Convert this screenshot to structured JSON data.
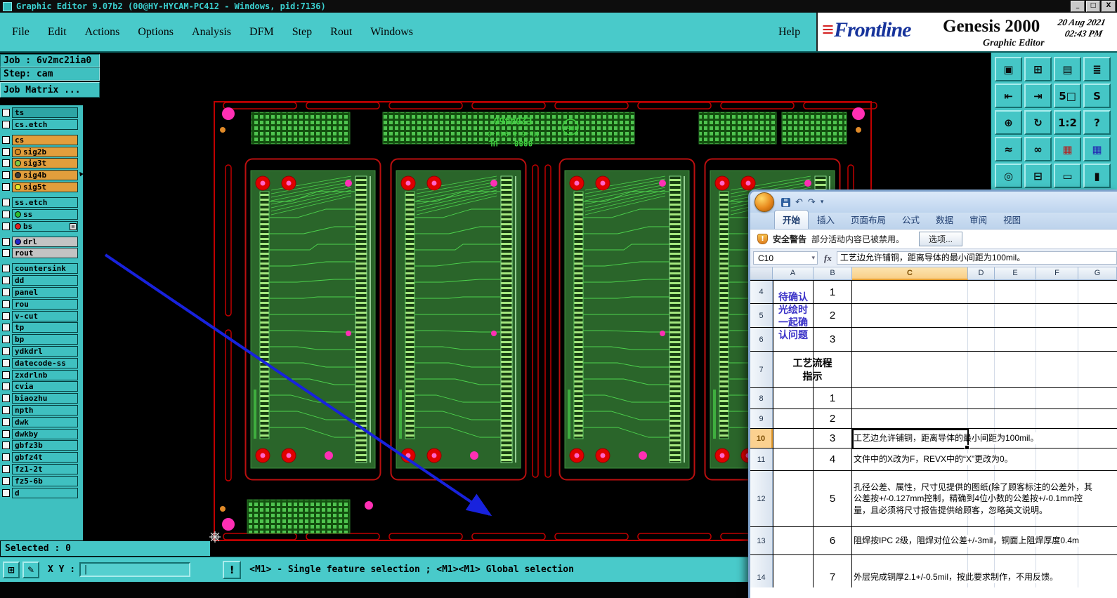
{
  "window": {
    "title": "Graphic Editor 9.07b2 (00@HY-HYCAM-PC412 - Windows, pid:7136)",
    "minimize": "_",
    "maximize": "□",
    "close": "X"
  },
  "menu": {
    "items": [
      "File",
      "Edit",
      "Actions",
      "Options",
      "Analysis",
      "DFM",
      "Step",
      "Rout",
      "Windows"
    ],
    "help": "Help"
  },
  "brand": {
    "logo_glyph": "≡",
    "name": "Frontline",
    "product": "Genesis 2000",
    "date": "20 Aug 2021",
    "time": "02:43 PM",
    "subtitle": "Graphic Editor"
  },
  "job_panel": {
    "job": "Job : 6v2mc21ia0",
    "step": "Step: cam",
    "matrix": "Job Matrix ..."
  },
  "layers": [
    {
      "name": "ts",
      "type": "teal",
      "active": true
    },
    {
      "name": "cs.etch",
      "type": "teal"
    },
    {
      "name": "cs",
      "type": "orange",
      "gap": true
    },
    {
      "name": "sig2b",
      "type": "orange",
      "dot": "#d98c1f"
    },
    {
      "name": "sig3t",
      "type": "orange",
      "dot": "#7fc843"
    },
    {
      "name": "sig4b",
      "type": "orange",
      "dot": "#3c3c3c",
      "cursor": true
    },
    {
      "name": "sig5t",
      "type": "orange",
      "dot": "#e8e82a"
    },
    {
      "name": "ss.etch",
      "type": "teal",
      "gap": true
    },
    {
      "name": "ss",
      "type": "teal",
      "dot": "#2fbf2f"
    },
    {
      "name": "bs",
      "type": "teal",
      "dot": "#e02020",
      "tag": true
    },
    {
      "name": "drl",
      "type": "gray",
      "dot": "#2424c8",
      "gap": true
    },
    {
      "name": "rout",
      "type": "gray"
    },
    {
      "name": "countersink",
      "type": "teal",
      "gap": true
    },
    {
      "name": "dd",
      "type": "teal"
    },
    {
      "name": "panel",
      "type": "teal"
    },
    {
      "name": "rou",
      "type": "teal"
    },
    {
      "name": "v-cut",
      "type": "teal"
    },
    {
      "name": "tp",
      "type": "teal"
    },
    {
      "name": "bp",
      "type": "teal"
    },
    {
      "name": "ydkdrl",
      "type": "teal"
    },
    {
      "name": "datecode-ss",
      "type": "teal"
    },
    {
      "name": "zxdrlnb",
      "type": "teal"
    },
    {
      "name": "cvia",
      "type": "teal"
    },
    {
      "name": "biaozhu",
      "type": "teal"
    },
    {
      "name": "npth",
      "type": "teal"
    },
    {
      "name": "dwk",
      "type": "teal"
    },
    {
      "name": "dwkby",
      "type": "teal"
    },
    {
      "name": "gbfz3b",
      "type": "teal"
    },
    {
      "name": "gbfz4t",
      "type": "teal"
    },
    {
      "name": "fz1-2t",
      "type": "teal"
    },
    {
      "name": "fz5-6b",
      "type": "teal"
    },
    {
      "name": "d",
      "type": "teal"
    }
  ],
  "toolbar_right": [
    {
      "name": "screen",
      "glyph": "▣"
    },
    {
      "name": "swap-display",
      "glyph": "⊞"
    },
    {
      "name": "cam-view",
      "glyph": "▤"
    },
    {
      "name": "layer-stack",
      "glyph": "≣"
    },
    {
      "name": "pan-in",
      "glyph": "⇤"
    },
    {
      "name": "pan-out",
      "glyph": "⇥"
    },
    {
      "name": "zoom-5",
      "glyph": "5□"
    },
    {
      "name": "select-s",
      "glyph": "S"
    },
    {
      "name": "fit-all",
      "glyph": "⊕"
    },
    {
      "name": "rotate",
      "glyph": "↻"
    },
    {
      "name": "zoom-1-2",
      "glyph": "1:2"
    },
    {
      "name": "help",
      "glyph": "?"
    },
    {
      "name": "profile",
      "glyph": "≈"
    },
    {
      "name": "netlist",
      "glyph": "∞"
    },
    {
      "name": "grid-red",
      "glyph": "▦",
      "color": "#b22222"
    },
    {
      "name": "grid-blue",
      "glyph": "▦",
      "color": "#2222b2"
    },
    {
      "name": "origin",
      "glyph": "◎"
    },
    {
      "name": "display",
      "glyph": "⊟"
    },
    {
      "name": "ruler",
      "glyph": "▭"
    },
    {
      "name": "fill",
      "glyph": "▮"
    }
  ],
  "status": {
    "selected": "Selected : 0",
    "xy_label": "X Y :",
    "caret": "|",
    "alert": "!",
    "message": "<M1> - Single feature selection ; <M1><M1> Global selection",
    "buttons": [
      {
        "name": "grid",
        "glyph": "⊞"
      },
      {
        "name": "draw",
        "glyph": "✎"
      }
    ]
  },
  "pcb": {
    "part_number": "E204460",
    "material": "ML-6 & 94V-0",
    "code": "8888",
    "ul_mark": "UL",
    "pb_mark": "Pb"
  },
  "excel": {
    "tabs": [
      "开始",
      "插入",
      "页面布局",
      "公式",
      "数据",
      "审阅",
      "视图"
    ],
    "qat": {
      "undo": "↶",
      "redo": "↷",
      "more": "▾"
    },
    "security": {
      "icon": "!",
      "label": "安全警告",
      "message": "部分活动内容已被禁用。",
      "options_button": "选项..."
    },
    "name_box": "C10",
    "dropdown_glyph": "▾",
    "fx": "fx",
    "formula": "工艺边允许铺铜，距离导体的最小间距为100mil。",
    "columns": [
      "A",
      "B",
      "C",
      "D",
      "E",
      "F",
      "G"
    ],
    "selected_cell": "C10",
    "merged_a_rows4to6_lines": [
      "待确认",
      "光绘时",
      "一起确",
      "认问题"
    ],
    "merged_a_row7_lines": [
      "工艺流程",
      "指示"
    ],
    "rows": [
      {
        "n": "4",
        "b": "1",
        "c": []
      },
      {
        "n": "5",
        "b": "2",
        "c": []
      },
      {
        "n": "6",
        "b": "3",
        "c": []
      },
      {
        "n": "7",
        "b": "",
        "c": []
      },
      {
        "n": "8",
        "b": "1",
        "c": []
      },
      {
        "n": "9",
        "b": "2",
        "c": []
      },
      {
        "n": "10",
        "b": "3",
        "selected": true,
        "c": [
          "工艺边允许铺铜，距离导体的最小间距为100mil。"
        ]
      },
      {
        "n": "11",
        "b": "4",
        "c": [
          "文件中的X改为F，REVX中的“X”更改为0。"
        ]
      },
      {
        "n": "12",
        "b": "5",
        "c": [
          "孔径公差、属性，尺寸见提供的图纸(除了顾客标注的公差外，其",
          "公差按+/-0.127mm控制，精确到4位小数的公差按+/-0.1mm控",
          "量，且必须将尺寸报告提供给顾客，忽略英文说明。"
        ]
      },
      {
        "n": "13",
        "b": "6",
        "c": [
          "阻焊按IPC 2级，阻焊对位公差+/-3mil，铜面上阻焊厚度0.4m"
        ]
      },
      {
        "n": "14",
        "b": "7",
        "c": [
          "外层完成铜厚2.1+/-0.5mil，按此要求制作，不用反馈。"
        ]
      }
    ]
  },
  "colors": {
    "teal": "#46c6c6",
    "orange_layer": "#e29e3c",
    "gray_layer": "#c3c3c3",
    "board_red": "#c00000",
    "trace_green": "#4dd24d",
    "pad_magenta": "#ff2fb4",
    "arrow_blue": "#1822dd",
    "selection_amber": "#fbd190",
    "excel_chrome": "#c7daf0"
  }
}
